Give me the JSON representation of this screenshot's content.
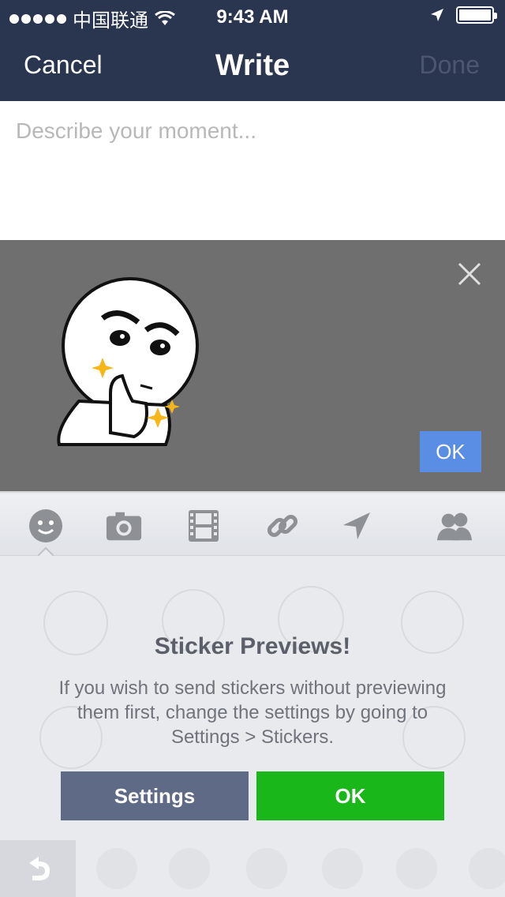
{
  "status_bar": {
    "carrier": "中国联通",
    "time": "9:43 AM",
    "signal_icon": "signal-dots-icon",
    "wifi_icon": "wifi-icon",
    "location_icon": "location-arrow-icon",
    "battery_icon": "battery-icon"
  },
  "nav": {
    "cancel_label": "Cancel",
    "title": "Write",
    "done_label": "Done"
  },
  "compose": {
    "placeholder": "Describe your moment..."
  },
  "preview": {
    "ok_label": "OK",
    "close_icon": "close-icon"
  },
  "toolbar": {
    "items": [
      {
        "icon": "sticker-face-icon"
      },
      {
        "icon": "camera-icon"
      },
      {
        "icon": "film-icon"
      },
      {
        "icon": "link-icon"
      },
      {
        "icon": "location-arrow-icon"
      },
      {
        "icon": "friends-icon"
      }
    ]
  },
  "sticker_panel": {
    "heading": "Sticker Previews!",
    "description": "If you wish to send stickers without previewing them first, change the settings by going to Settings > Stickers.",
    "settings_label": "Settings",
    "ok_label": "OK"
  },
  "colors": {
    "nav_bg": "#2a3650",
    "preview_bg": "#6f6f6f",
    "ok_blue": "#5a8ee5",
    "settings_btn": "#5e6a86",
    "ok_green": "#1ab71a"
  }
}
